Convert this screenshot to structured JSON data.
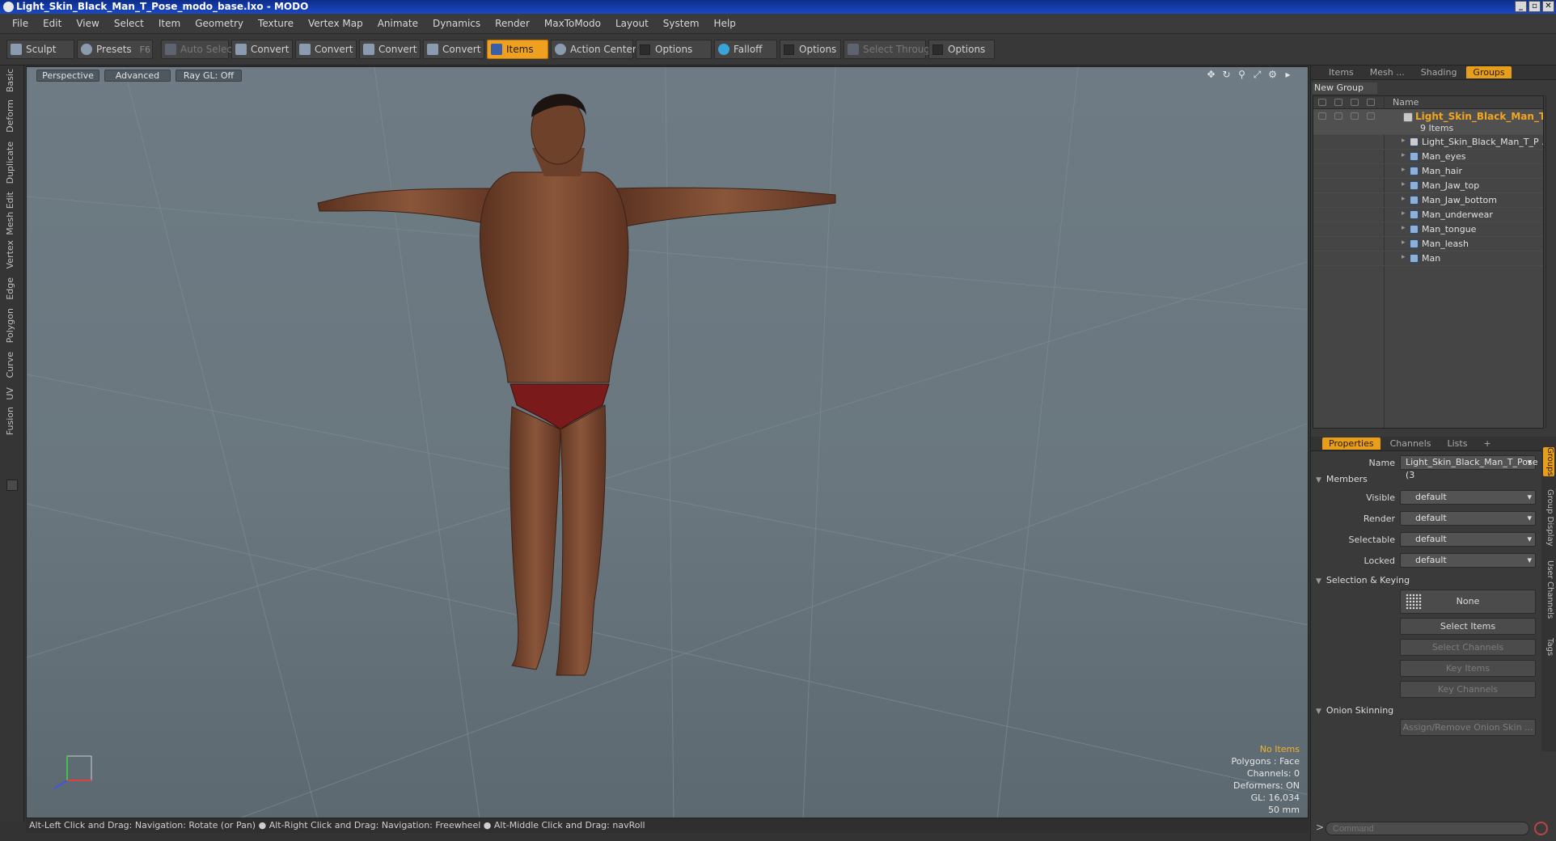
{
  "window": {
    "title": "Light_Skin_Black_Man_T_Pose_modo_base.lxo - MODO",
    "buttons": [
      "_",
      "▫",
      "✕"
    ]
  },
  "menu": [
    "File",
    "Edit",
    "View",
    "Select",
    "Item",
    "Geometry",
    "Texture",
    "Vertex Map",
    "Animate",
    "Dynamics",
    "Render",
    "MaxToModo",
    "Layout",
    "System",
    "Help"
  ],
  "toolbar": {
    "sculpt": "Sculpt",
    "presets": "Presets",
    "presets_key": "F6",
    "auto_select": "Auto Select",
    "convert1": "Convert",
    "convert2": "Convert",
    "convert3": "Convert",
    "convert4": "Convert",
    "items": "Items",
    "action_center": "Action Center",
    "options1": "Options",
    "falloff": "Falloff",
    "options2": "Options",
    "select_through": "Select Through",
    "options3": "Options"
  },
  "left_tabs": [
    "Basic",
    "Deform",
    "Duplicate",
    "Mesh Edit",
    "Vertex",
    "Edge",
    "Polygon",
    "Curve",
    "UV",
    "Fusion"
  ],
  "viewport": {
    "view": "Perspective",
    "shading": "Advanced",
    "raygl": "Ray GL: Off",
    "hud": {
      "selection": "No Items",
      "polygons": "Polygons : Face",
      "channels": "Channels: 0",
      "deformers": "Deformers: ON",
      "gl": "GL: 16,034",
      "focal": "50 mm"
    }
  },
  "status": "Alt-Left Click and Drag: Navigation: Rotate (or Pan) ● Alt-Right Click and Drag: Navigation: Freewheel ● Alt-Middle Click and Drag: navRoll",
  "panel_tabs": {
    "items": "Items",
    "mesh": "Mesh ...",
    "shading": "Shading",
    "groups": "Groups"
  },
  "groups": {
    "new_group": "New Group",
    "name_header": "Name",
    "group_name": "Light_Skin_Black_Man_T...",
    "group_count": "9 Items",
    "items": [
      "Light_Skin_Black_Man_T_P ...",
      "Man_eyes",
      "Man_hair",
      "Man_Jaw_top",
      "Man_Jaw_bottom",
      "Man_underwear",
      "Man_tongue",
      "Man_leash",
      "Man"
    ]
  },
  "props_tabs": {
    "properties": "Properties",
    "channels": "Channels",
    "lists": "Lists",
    "add": "+"
  },
  "properties": {
    "name_label": "Name",
    "name_value": "Light_Skin_Black_Man_T_Pose (3",
    "members": "Members",
    "visible_label": "Visible",
    "visible_value": "default",
    "render_label": "Render",
    "render_value": "default",
    "selectable_label": "Selectable",
    "selectable_value": "default",
    "locked_label": "Locked",
    "locked_value": "default",
    "selection_keying": "Selection & Keying",
    "none": "None",
    "select_items": "Select Items",
    "select_channels": "Select Channels",
    "key_items": "Key Items",
    "key_channels": "Key Channels",
    "onion": "Onion Skinning",
    "assign_onion": "Assign/Remove Onion Skin ..."
  },
  "side_tabs": [
    "Groups",
    "Group Display",
    "User Channels",
    "Tags"
  ],
  "command": {
    "prompt": ">",
    "placeholder": "Command"
  },
  "colors": {
    "accent": "#e79e1a",
    "titlebar": "#1a48c4",
    "viewport_bg": "#6e7b84",
    "skin": "#7a4a32",
    "underwear": "#7a1a1a"
  }
}
